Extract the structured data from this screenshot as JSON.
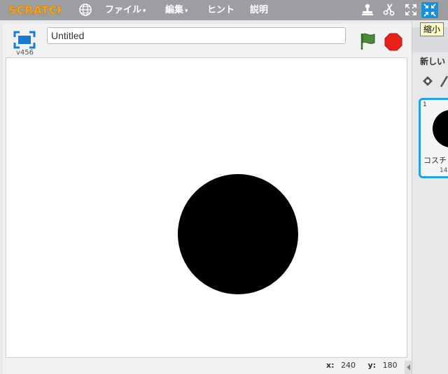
{
  "menubar": {
    "logo_text": "SCRATCH",
    "file_label": "ファイル",
    "edit_label": "編集",
    "tips_label": "ヒント",
    "about_label": "説明",
    "dropdown_arrow": "▾"
  },
  "tooltip": {
    "text": "縮小"
  },
  "stage_header": {
    "version": "v456",
    "title_value": "Untitled"
  },
  "stage": {
    "sprite_color": "#000000"
  },
  "coords": {
    "x_label": "x:",
    "x_value": "240",
    "y_label": "y:",
    "y_value": "180"
  },
  "side_panel": {
    "new_costume_label": "新しい",
    "costume_number": "1",
    "costume_name": "コスチ",
    "costume_size": "14"
  },
  "colors": {
    "menubar": "#9c9ea2",
    "accent_blue": "#1a90d6",
    "flag_green": "#4a8a3a",
    "stop_red": "#e8211d"
  },
  "icons": [
    "globe-icon",
    "stamp-icon",
    "scissors-icon",
    "grow-icon",
    "shrink-icon",
    "present-mode-icon",
    "green-flag-icon",
    "stop-icon",
    "paint-icon",
    "brush-icon"
  ]
}
